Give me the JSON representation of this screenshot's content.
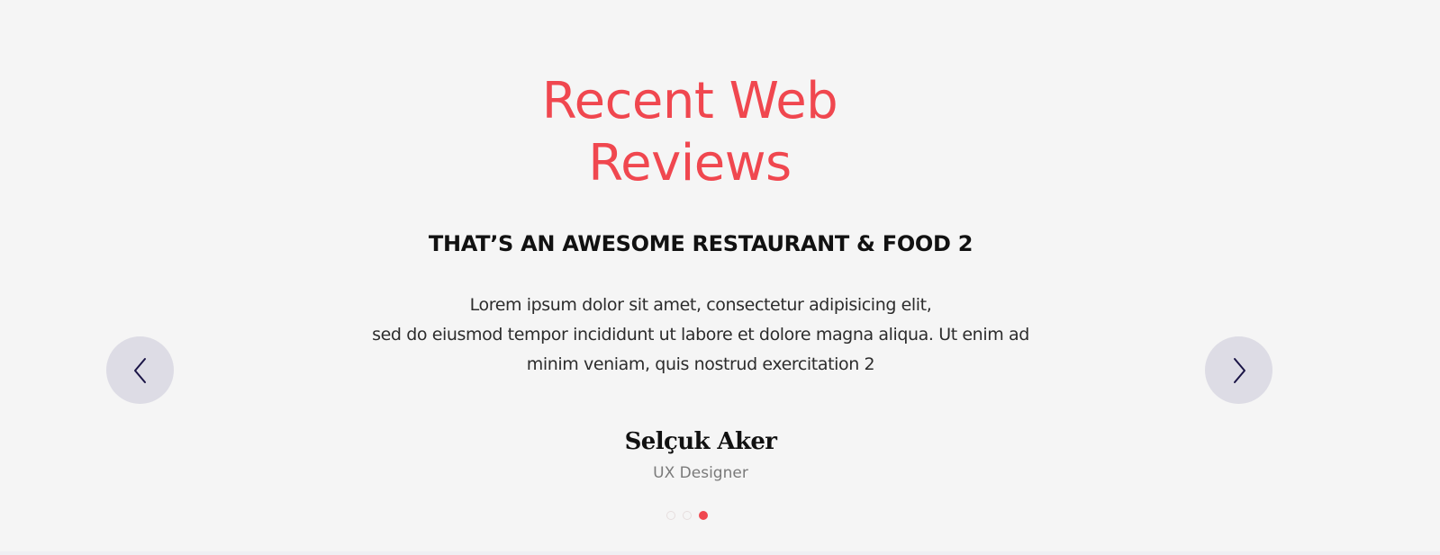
{
  "section": {
    "title_line1": "Recent Web",
    "title_line2": "Reviews"
  },
  "review": {
    "heading": "THAT’S AN AWESOME RESTAURANT & FOOD 2",
    "body_line1": "Lorem ipsum dolor sit amet, consectetur adipisicing elit,",
    "body_line2": "sed do eiusmod tempor incididunt ut labore et dolore magna aliqua. Ut enim ad",
    "body_line3": "minim veniam, quis nostrud exercitation 2",
    "author_name": "Selçuk Aker",
    "author_role": "UX Designer"
  },
  "navigation": {
    "prev_icon": "chevron-left-icon",
    "next_icon": "chevron-right-icon"
  },
  "pagination": {
    "total": 3,
    "active_index": 3
  },
  "colors": {
    "accent": "#f0474f",
    "background": "#f5f5f5",
    "nav_button": "#dddce5",
    "nav_arrow": "#1a1446"
  }
}
